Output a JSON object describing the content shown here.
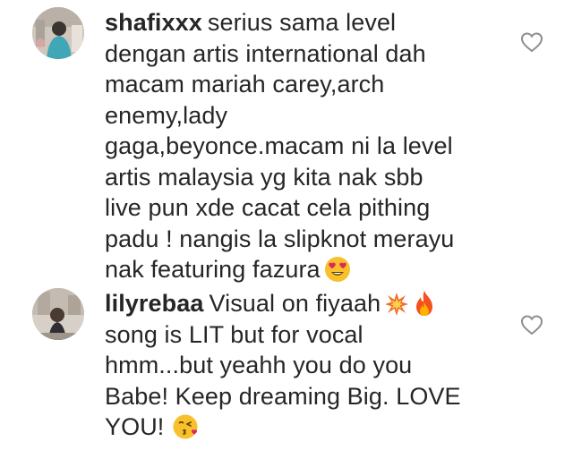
{
  "comments": [
    {
      "username": "shafixxx",
      "lines": [
        "serius sama level",
        "dengan artis international dah",
        "macam mariah carey,arch",
        "enemy,lady",
        "gaga,beyonce.macam ni la level",
        "artis malaysia yg kita nak sbb",
        "live pun xde cacat cela pithing",
        "padu ! nangis la slipknot merayu",
        "nak featuring fazura"
      ],
      "emoji": [
        "heart-eyes-emoji"
      ]
    },
    {
      "username": "lilyrebaa",
      "lines": [
        "Visual on fiyaah",
        "song is LIT but for vocal",
        "hmm...but yeahh you do you",
        "Babe! Keep dreaming Big. LOVE",
        "YOU!"
      ],
      "emoji": [
        "collision-emoji",
        "fire-emoji",
        "kissing-heart-emoji"
      ]
    }
  ],
  "icons": {
    "like": "heart-outline-icon"
  },
  "colors": {
    "text": "#262626",
    "heart_outline": "#8e8e8e",
    "emoji_yellow": "#f7c02c",
    "heart_red": "#e0245e"
  }
}
